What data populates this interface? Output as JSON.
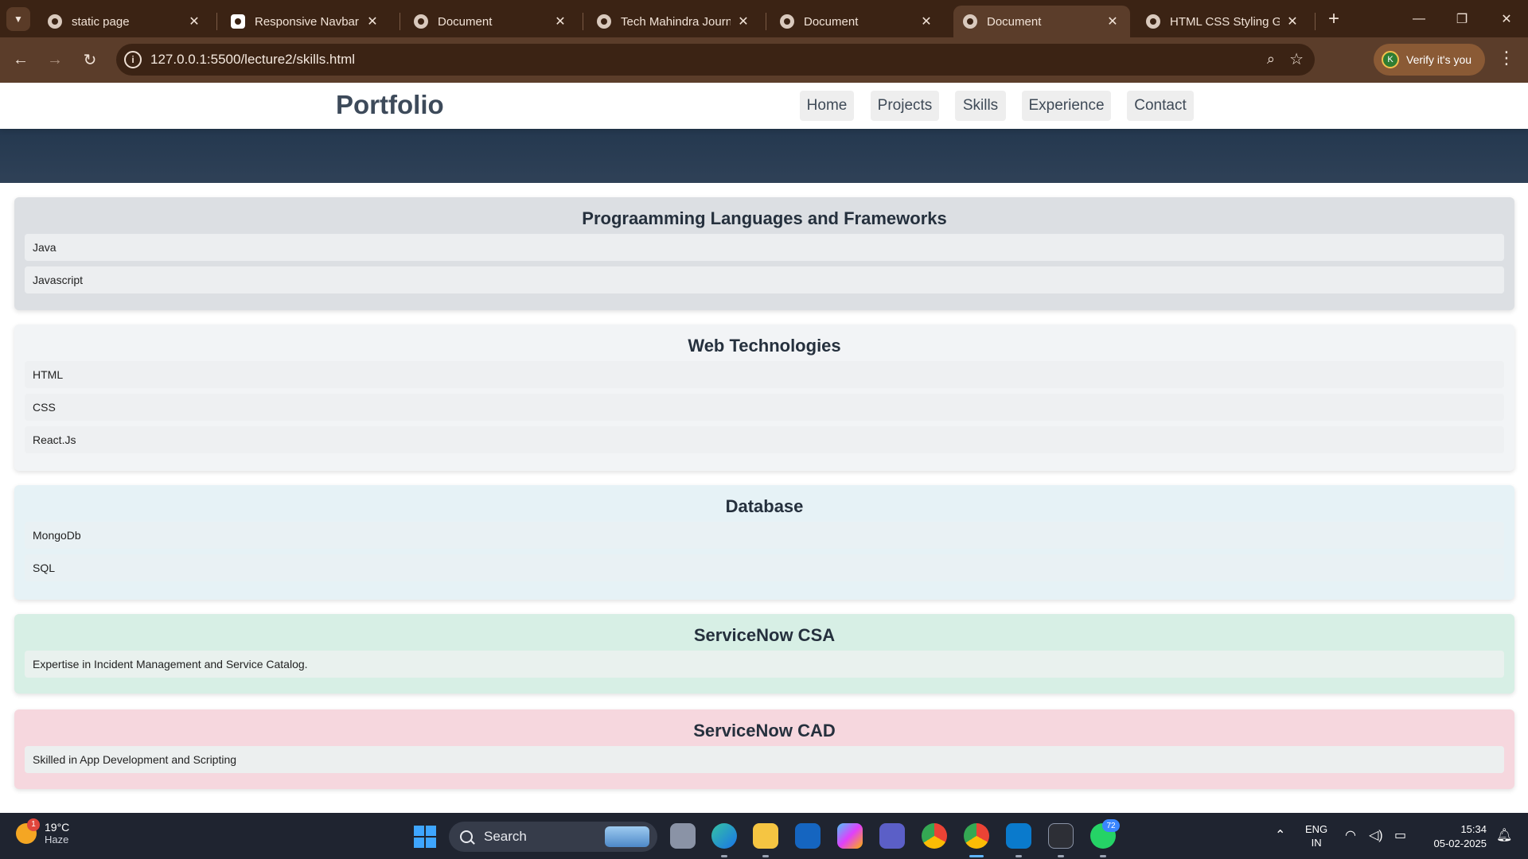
{
  "browser": {
    "tabs": [
      {
        "title": "static page"
      },
      {
        "title": "Responsive Navbar (HT"
      },
      {
        "title": "Document"
      },
      {
        "title": "Tech Mahindra Journey"
      },
      {
        "title": "Document"
      },
      {
        "title": "Document"
      },
      {
        "title": "HTML CSS Styling Guid"
      }
    ],
    "active_tab_index": 5,
    "url": "127.0.0.1:5500/lecture2/skills.html",
    "verify_label": "Verify it's you",
    "profile_initial": "K",
    "close_glyph": "✕",
    "new_tab_glyph": "+",
    "icons": {
      "tab_list": "chevron-down-icon",
      "back": "back-arrow-icon",
      "forward": "forward-arrow-icon",
      "reload": "reload-icon",
      "site_info": "info-icon",
      "zoom": "zoom-icon",
      "bookmark": "star-icon",
      "menu": "kebab-menu-icon"
    }
  },
  "site": {
    "brand": "Portfolio",
    "nav": [
      {
        "label": "Home"
      },
      {
        "label": "Projects"
      },
      {
        "label": "Skills"
      },
      {
        "label": "Experience"
      },
      {
        "label": "Contact"
      }
    ]
  },
  "sections": [
    {
      "title": "Prograamming Languages and Frameworks",
      "bg": "#dcdfe3",
      "items": [
        "Java",
        "Javascript"
      ]
    },
    {
      "title": "Web Technologies",
      "bg": "#f2f4f6",
      "items": [
        "HTML",
        "CSS",
        "React.Js"
      ]
    },
    {
      "title": "Database",
      "bg": "#e6f2f6",
      "items": [
        "MongoDb",
        "SQL"
      ]
    },
    {
      "title": "ServiceNow CSA",
      "bg": "#d7efe5",
      "items": [
        "Expertise in Incident Management and Service Catalog."
      ]
    },
    {
      "title": "ServiceNow CAD",
      "bg": "#f6d7de",
      "items": [
        "Skilled in App Development and Scripting"
      ]
    }
  ],
  "colors": {
    "tab_strip": "#3b2314",
    "toolbar": "#5b3d2a",
    "hero": "#2c3e50",
    "taskbar": "#1f2430"
  },
  "taskbar": {
    "weather_temp": "19°C",
    "weather_desc": "Haze",
    "weather_badge": "1",
    "search_label": "Search",
    "whatsapp_badge": "72",
    "lang_line1": "ENG",
    "lang_line2": "IN",
    "time": "15:34",
    "date": "05-02-2025",
    "apps": [
      "task-view-icon",
      "edge-icon",
      "file-explorer-icon",
      "outlook-icon",
      "copilot-icon",
      "teams-icon",
      "chrome-icon",
      "chrome-profile-icon",
      "vscode-icon",
      "terminal-icon",
      "whatsapp-icon"
    ]
  }
}
